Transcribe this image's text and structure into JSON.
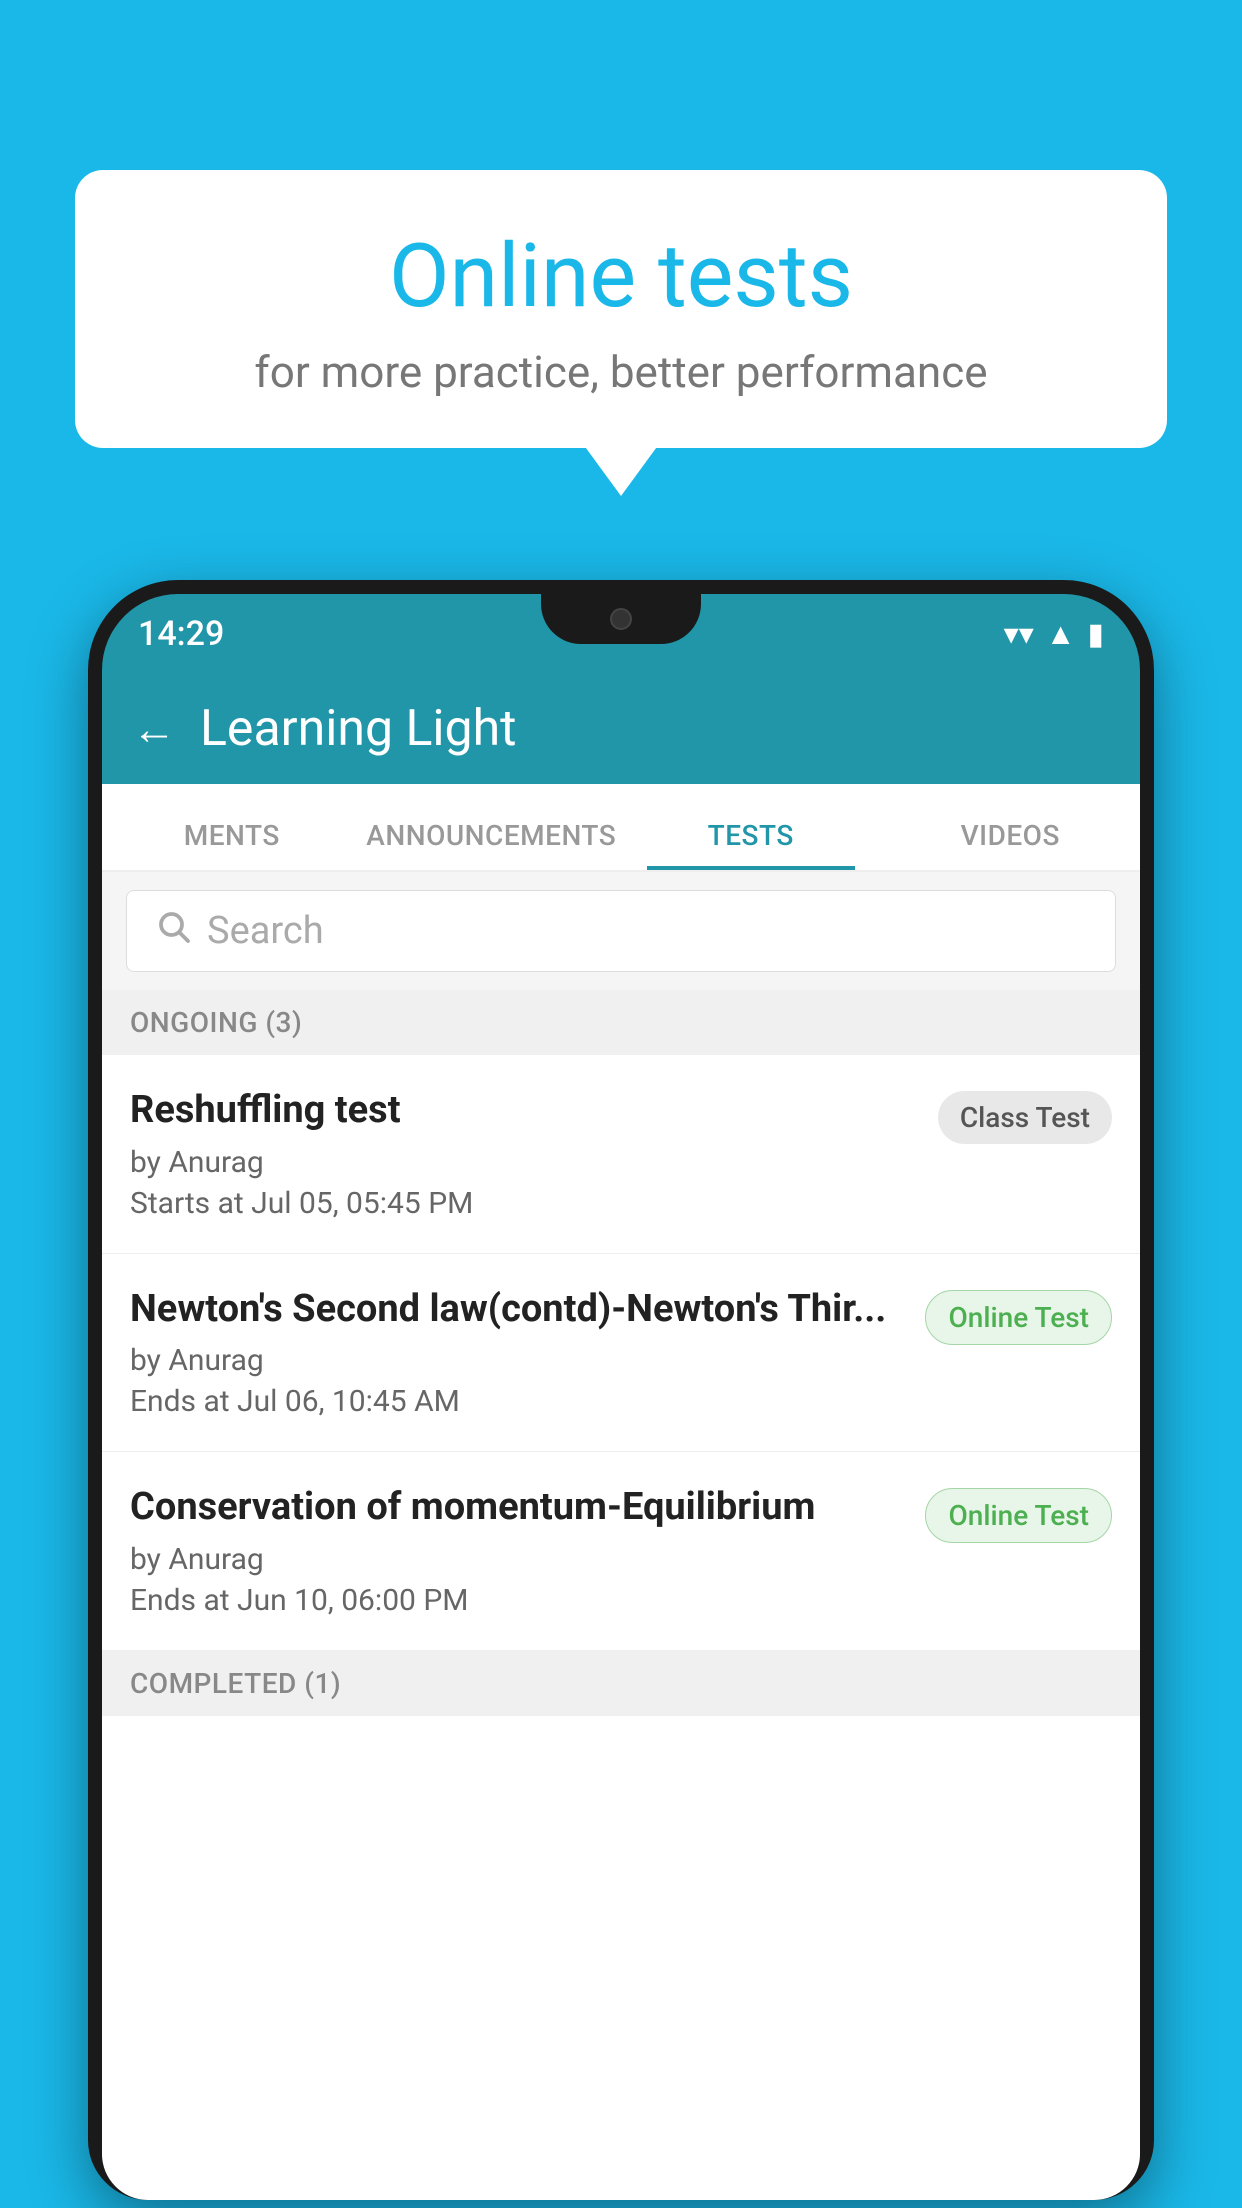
{
  "background": {
    "color": "#1ab8e8"
  },
  "speechBubble": {
    "title": "Online tests",
    "subtitle": "for more practice, better performance"
  },
  "phone": {
    "statusBar": {
      "time": "14:29",
      "wifi": "▼",
      "signal": "▲",
      "battery": "▮"
    },
    "header": {
      "backLabel": "←",
      "title": "Learning Light"
    },
    "tabs": [
      {
        "label": "MENTS",
        "active": false
      },
      {
        "label": "ANNOUNCEMENTS",
        "active": false
      },
      {
        "label": "TESTS",
        "active": true
      },
      {
        "label": "VIDEOS",
        "active": false
      }
    ],
    "search": {
      "placeholder": "Search"
    },
    "sections": [
      {
        "label": "ONGOING (3)",
        "tests": [
          {
            "name": "Reshuffling test",
            "author": "by Anurag",
            "time": "Starts at  Jul 05, 05:45 PM",
            "badge": "Class Test",
            "badgeType": "class"
          },
          {
            "name": "Newton's Second law(contd)-Newton's Thir...",
            "author": "by Anurag",
            "time": "Ends at  Jul 06, 10:45 AM",
            "badge": "Online Test",
            "badgeType": "online"
          },
          {
            "name": "Conservation of momentum-Equilibrium",
            "author": "by Anurag",
            "time": "Ends at  Jun 10, 06:00 PM",
            "badge": "Online Test",
            "badgeType": "online"
          }
        ]
      },
      {
        "label": "COMPLETED (1)",
        "tests": []
      }
    ]
  }
}
